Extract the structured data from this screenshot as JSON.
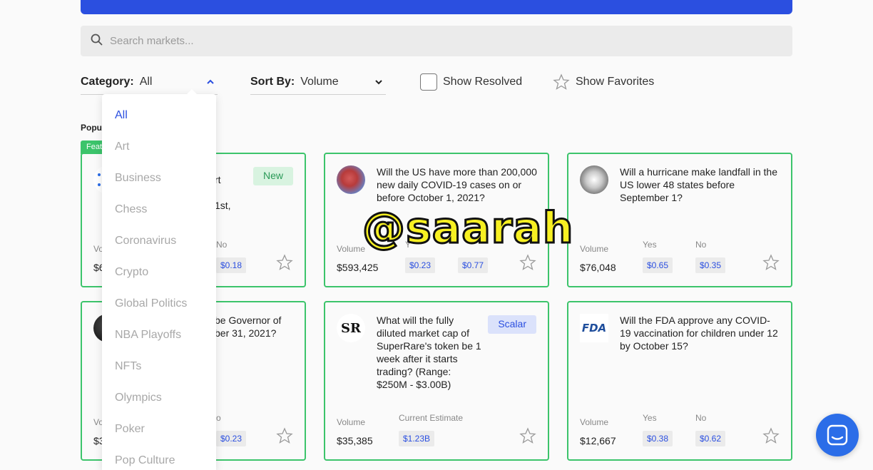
{
  "search": {
    "placeholder": "Search markets..."
  },
  "filters": {
    "category_label": "Category:",
    "category_value": "All",
    "sort_label": "Sort By:",
    "sort_value": "Volume",
    "show_resolved": "Show Resolved",
    "show_favorites": "Show Favorites"
  },
  "section_title": "Popu",
  "featured_tag": "Feat",
  "category_options": [
    "All",
    "Art",
    "Business",
    "Chess",
    "Coronavirus",
    "Crypto",
    "Global Politics",
    "NBA Playoffs",
    "NFTs",
    "Olympics",
    "Poker",
    "Pop Culture"
  ],
  "cards": [
    {
      "question": "rt\n1st,",
      "badge": "New",
      "volume_label": "Vo",
      "volume": "$6",
      "yes_label": "",
      "yes_price": "",
      "no_label": "No",
      "no_price": "$0.18"
    },
    {
      "question": "Will the US have more than 200,000 new daily COVID-19 cases on or before October 1, 2021?",
      "badge": "",
      "volume_label": "Volume",
      "volume": "$593,425",
      "yes_label": "Y",
      "yes_price": "$0.23",
      "no_label": "",
      "no_price": "$0.77"
    },
    {
      "question": "Will a hurricane make landfall in the US lower 48 states before September 1?",
      "badge": "",
      "volume_label": "Volume",
      "volume": "$76,048",
      "yes_label": "Yes",
      "yes_price": "$0.65",
      "no_label": "No",
      "no_price": "$0.35"
    },
    {
      "question": "be Governor of\nber 31, 2021?",
      "badge": "",
      "volume_label": "Vo",
      "volume": "$3",
      "yes_label": "",
      "yes_price": "",
      "no_label": "o",
      "no_price": "$0.23"
    },
    {
      "question": "What will the fully diluted market cap of SuperRare's token be 1 week after it starts trading? (Range: $250M - $3.00B)",
      "badge": "Scalar",
      "volume_label": "Volume",
      "volume": "$35,385",
      "estimate_label": "Current Estimate",
      "estimate": "$1.23B",
      "avatar_text": "SR"
    },
    {
      "question": "Will the FDA approve any COVID-19 vaccination for children under 12 by October 15?",
      "badge": "",
      "volume_label": "Volume",
      "volume": "$12,667",
      "yes_label": "Yes",
      "yes_price": "$0.38",
      "no_label": "No",
      "no_price": "$0.62",
      "avatar_text": "FDA"
    }
  ],
  "watermark": "@saarah",
  "icons": {
    "search": "search-icon",
    "chevron": "chevron-icon",
    "star": "star-icon",
    "chat": "chat-icon"
  },
  "colors": {
    "accent": "#2b4fe0",
    "green": "#3cc46b"
  }
}
